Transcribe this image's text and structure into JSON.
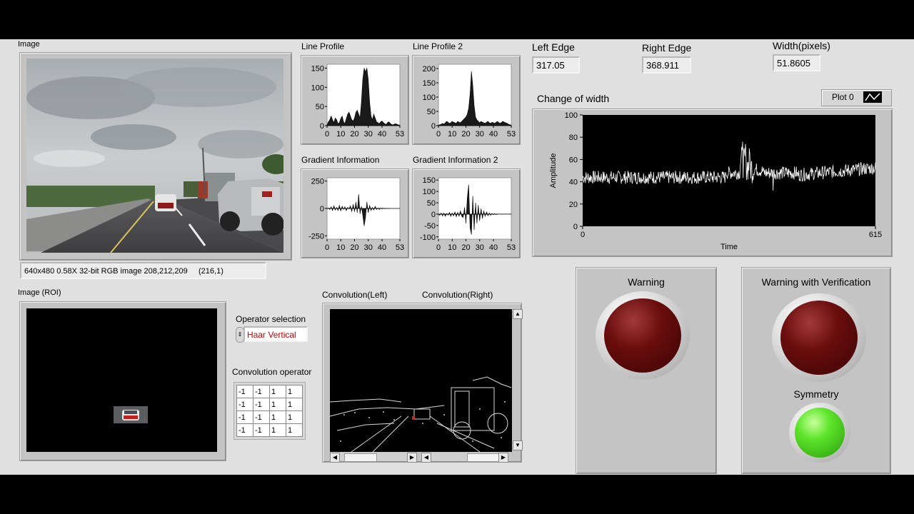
{
  "image_panel": {
    "title": "Image",
    "info": "640x480 0.58X 32-bit RGB image 208,212,209     (216,1)"
  },
  "roi_panel": {
    "title": "Image (ROI)"
  },
  "operator": {
    "label": "Operator selection",
    "value": "Haar Vertical"
  },
  "conv_operator": {
    "label": "Convolution operator",
    "rows": [
      [
        "-1",
        "-1",
        "1",
        "1"
      ],
      [
        "-1",
        "-1",
        "1",
        "1"
      ],
      [
        "-1",
        "-1",
        "1",
        "1"
      ],
      [
        "-1",
        "-1",
        "1",
        "1"
      ]
    ]
  },
  "conv_panel": {
    "left_label": "Convolution(Left)",
    "right_label": "Convolution(Right)"
  },
  "edges": {
    "left_label": "Left Edge",
    "left_value": "317.05",
    "right_label": "Right Edge",
    "right_value": "368.911",
    "width_label": "Width(pixels)",
    "width_value": "51.8605"
  },
  "width_chart": {
    "title": "Change of width",
    "legend": "Plot 0",
    "xlabel": "Time",
    "ylabel": "Amplitude"
  },
  "leds": {
    "warning_label": "Warning",
    "warning_state": "off",
    "verif_label": "Warning with Verification",
    "verif_state": "off",
    "symmetry_label": "Symmetry",
    "symmetry_state": "on",
    "off_color": "#6a0d0d",
    "on_color": "#5ee62a"
  },
  "chart_data": [
    {
      "type": "area",
      "title": "Line Profile",
      "x_range": [
        0,
        53
      ],
      "ylim": [
        0,
        160
      ],
      "yticks": [
        "150",
        "100",
        "50",
        "0"
      ],
      "xticks": [
        "0",
        "10",
        "20",
        "30",
        "40",
        "53"
      ],
      "values": [
        2,
        10,
        15,
        25,
        15,
        8,
        20,
        15,
        5,
        8,
        18,
        25,
        10,
        5,
        18,
        30,
        35,
        25,
        15,
        12,
        20,
        35,
        40,
        30,
        20,
        60,
        120,
        150,
        140,
        150,
        120,
        60,
        25,
        15,
        30,
        20,
        10,
        8,
        5,
        10,
        12,
        8,
        5,
        3,
        8,
        10,
        6,
        3,
        2,
        4,
        5,
        3,
        2,
        1
      ]
    },
    {
      "type": "area",
      "title": "Line Profile 2",
      "x_range": [
        0,
        53
      ],
      "ylim": [
        0,
        215
      ],
      "yticks": [
        "200",
        "150",
        "100",
        "50",
        "0"
      ],
      "xticks": [
        "0",
        "10",
        "20",
        "30",
        "40",
        "53"
      ],
      "values": [
        2,
        3,
        5,
        8,
        5,
        10,
        15,
        12,
        8,
        10,
        15,
        12,
        10,
        8,
        15,
        12,
        10,
        15,
        20,
        25,
        30,
        40,
        60,
        110,
        190,
        140,
        70,
        30,
        20,
        15,
        10,
        15,
        12,
        10,
        8,
        12,
        15,
        10,
        8,
        12,
        10,
        8,
        12,
        15,
        10,
        8,
        12,
        15,
        12,
        10,
        8,
        5,
        3,
        2
      ]
    },
    {
      "type": "area",
      "title": "Gradient Information",
      "x_range": [
        0,
        53
      ],
      "ylim": [
        -280,
        280
      ],
      "yticks": [
        "250",
        "0",
        "-250"
      ],
      "xticks": [
        "0",
        "10",
        "20",
        "30",
        "40",
        "53"
      ],
      "values": [
        0,
        5,
        -10,
        15,
        -20,
        25,
        -15,
        10,
        -20,
        30,
        -25,
        20,
        -10,
        15,
        -20,
        10,
        -5,
        25,
        -30,
        40,
        -30,
        60,
        -40,
        130,
        -50,
        20,
        -60,
        -160,
        -80,
        60,
        -40,
        30,
        -20,
        10,
        -15,
        20,
        -10,
        5,
        -10,
        5,
        -5,
        3,
        -3,
        2,
        -2,
        1,
        0,
        0,
        0,
        0,
        0,
        0,
        0,
        0
      ]
    },
    {
      "type": "area",
      "title": "Gradient Information 2",
      "x_range": [
        0,
        53
      ],
      "ylim": [
        -110,
        160
      ],
      "yticks": [
        "150",
        "100",
        "50",
        "0",
        "-50",
        "-100"
      ],
      "xticks": [
        "0",
        "10",
        "20",
        "30",
        "40",
        "53"
      ],
      "values": [
        0,
        -5,
        5,
        -8,
        5,
        -10,
        3,
        -5,
        8,
        -10,
        5,
        -8,
        10,
        -12,
        8,
        -10,
        15,
        -10,
        -15,
        30,
        -40,
        70,
        130,
        -60,
        -90,
        80,
        -70,
        50,
        -40,
        40,
        -30,
        25,
        -20,
        15,
        -10,
        10,
        -8,
        5,
        -5,
        3,
        -3,
        2,
        -2,
        1,
        0,
        0,
        0,
        0,
        0,
        0,
        0,
        0,
        0,
        0
      ]
    },
    {
      "type": "line",
      "title": "Change of width",
      "x_range": [
        0,
        615
      ],
      "ylim": [
        0,
        100
      ],
      "yticks": [
        "100",
        "80",
        "60",
        "40",
        "20",
        "0"
      ],
      "xticks": [
        "0",
        "615"
      ],
      "xlabel": "Time",
      "ylabel": "Amplitude",
      "series": [
        {
          "name": "Plot 0"
        }
      ]
    }
  ]
}
